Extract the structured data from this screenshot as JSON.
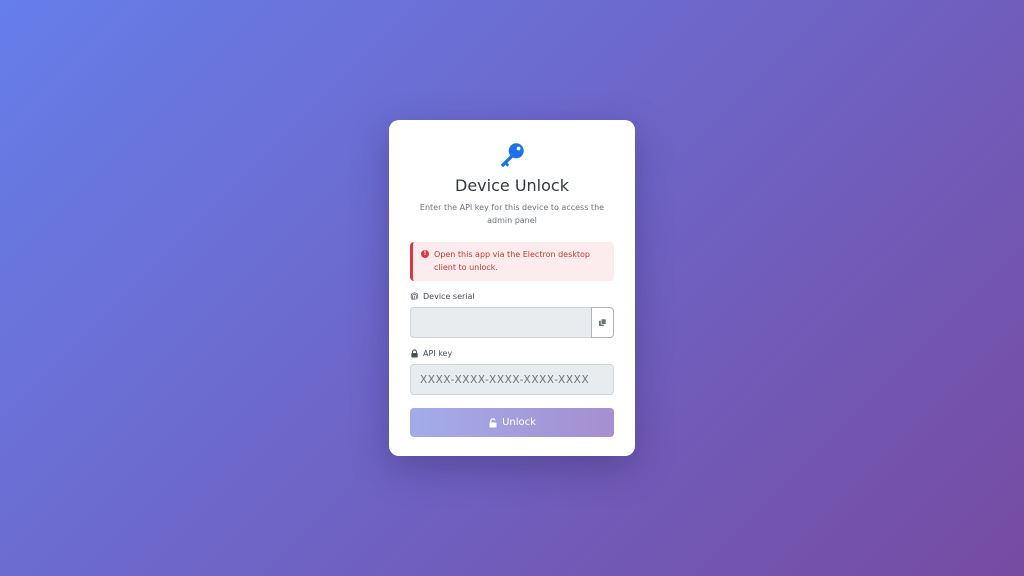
{
  "colors": {
    "background_start": "#667eea",
    "background_end": "#764ba2",
    "accent_icon": "#1a73e8",
    "alert_text": "#c0392b",
    "alert_border": "#dc3545"
  },
  "header": {
    "icon": "key-icon",
    "title": "Device Unlock",
    "subtitle": "Enter the API key for this device to access the admin panel"
  },
  "alert": {
    "icon": "exclamation-circle-icon",
    "message": "Open this app via the Electron desktop client to unlock."
  },
  "device_serial": {
    "icon": "fingerprint-icon",
    "label": "Device serial",
    "value": "",
    "copy_icon": "copy-icon"
  },
  "api_key": {
    "icon": "lock-icon",
    "label": "API key",
    "value": "",
    "placeholder": "XXXX-XXXX-XXXX-XXXX-XXXX"
  },
  "unlock_button": {
    "icon": "unlock-icon",
    "label": "Unlock",
    "state": "disabled"
  }
}
